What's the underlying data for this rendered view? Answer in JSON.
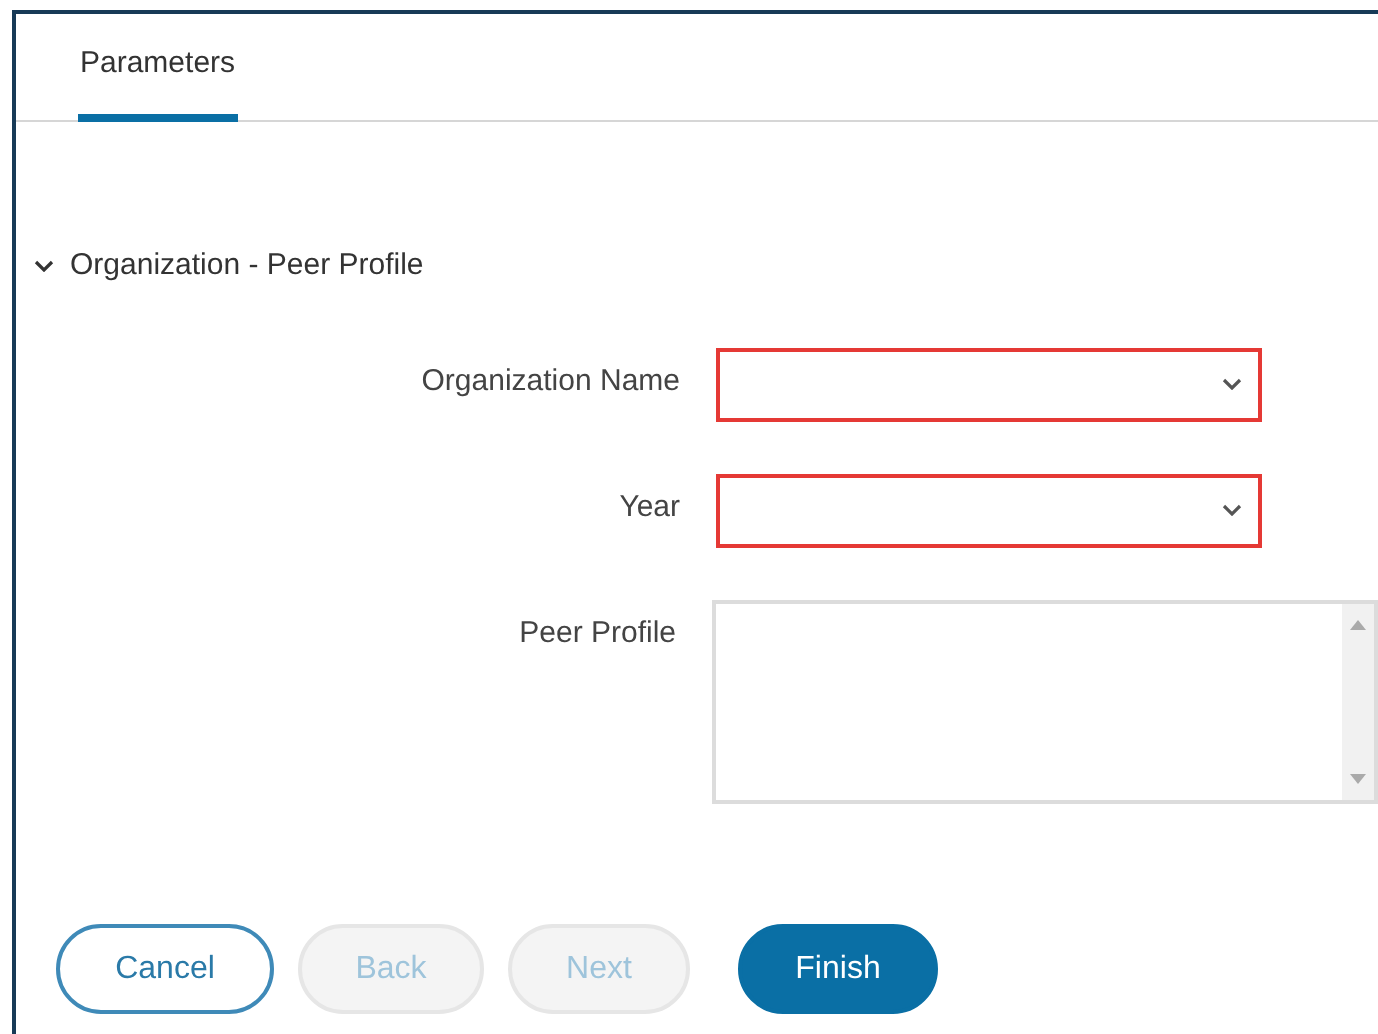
{
  "tabs": [
    {
      "label": "Parameters",
      "selected": true
    }
  ],
  "section": {
    "title": "Organization - Peer Profile",
    "expanded": true
  },
  "fields": [
    {
      "kind": "select",
      "label": "Organization Name",
      "invalid": true
    },
    {
      "kind": "select",
      "label": "Year",
      "invalid": true
    },
    {
      "kind": "textarea",
      "label": "Peer Profile",
      "invalid": false
    }
  ],
  "buttons": [
    {
      "label": "Cancel",
      "kind": "outline",
      "disabled": false
    },
    {
      "label": "Back",
      "kind": "outline",
      "disabled": true
    },
    {
      "label": "Next",
      "kind": "outline",
      "disabled": true
    },
    {
      "label": "Finish",
      "kind": "primary",
      "disabled": false
    }
  ]
}
